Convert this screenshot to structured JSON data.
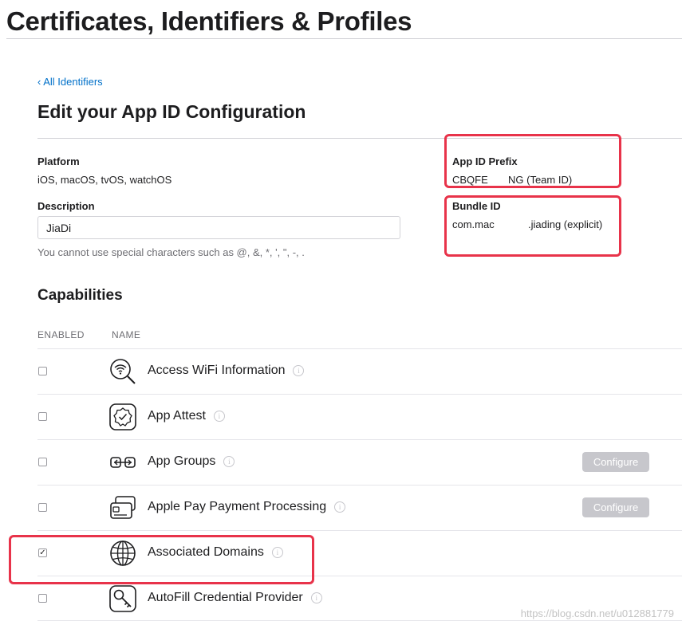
{
  "page": {
    "title": "Certificates, Identifiers & Profiles",
    "back_link": "‹ All Identifiers",
    "heading": "Edit your App ID Configuration"
  },
  "platform": {
    "label": "Platform",
    "value": "iOS, macOS, tvOS, watchOS"
  },
  "description": {
    "label": "Description",
    "value": "JiaDi",
    "hint": "You cannot use special characters such as @, &, *, ', \", -, ."
  },
  "app_id_prefix": {
    "label": "App ID Prefix",
    "value_start": "CBQFE",
    "value_end": "NG (Team ID)"
  },
  "bundle_id": {
    "label": "Bundle ID",
    "value_start": "com.mac",
    "value_end": ".jiading (explicit)"
  },
  "capabilities": {
    "heading": "Capabilities",
    "col_enabled": "ENABLED",
    "col_name": "NAME",
    "configure_label": "Configure",
    "items": [
      {
        "name": "Access WiFi Information",
        "icon": "wifi-search-icon",
        "checked": false,
        "configure": false
      },
      {
        "name": "App Attest",
        "icon": "app-attest-badge-icon",
        "checked": false,
        "configure": false
      },
      {
        "name": "App Groups",
        "icon": "app-groups-icon",
        "checked": false,
        "configure": true
      },
      {
        "name": "Apple Pay Payment Processing",
        "icon": "apple-pay-card-icon",
        "checked": false,
        "configure": true
      },
      {
        "name": "Associated Domains",
        "icon": "globe-icon",
        "checked": true,
        "configure": false
      },
      {
        "name": "AutoFill Credential Provider",
        "icon": "key-icon",
        "checked": false,
        "configure": false
      }
    ]
  },
  "watermark": "https://blog.csdn.net/u012881779",
  "colors": {
    "link": "#0070c9",
    "highlight_box": "#e8334a",
    "disabled_button": "#c7c7cc"
  }
}
